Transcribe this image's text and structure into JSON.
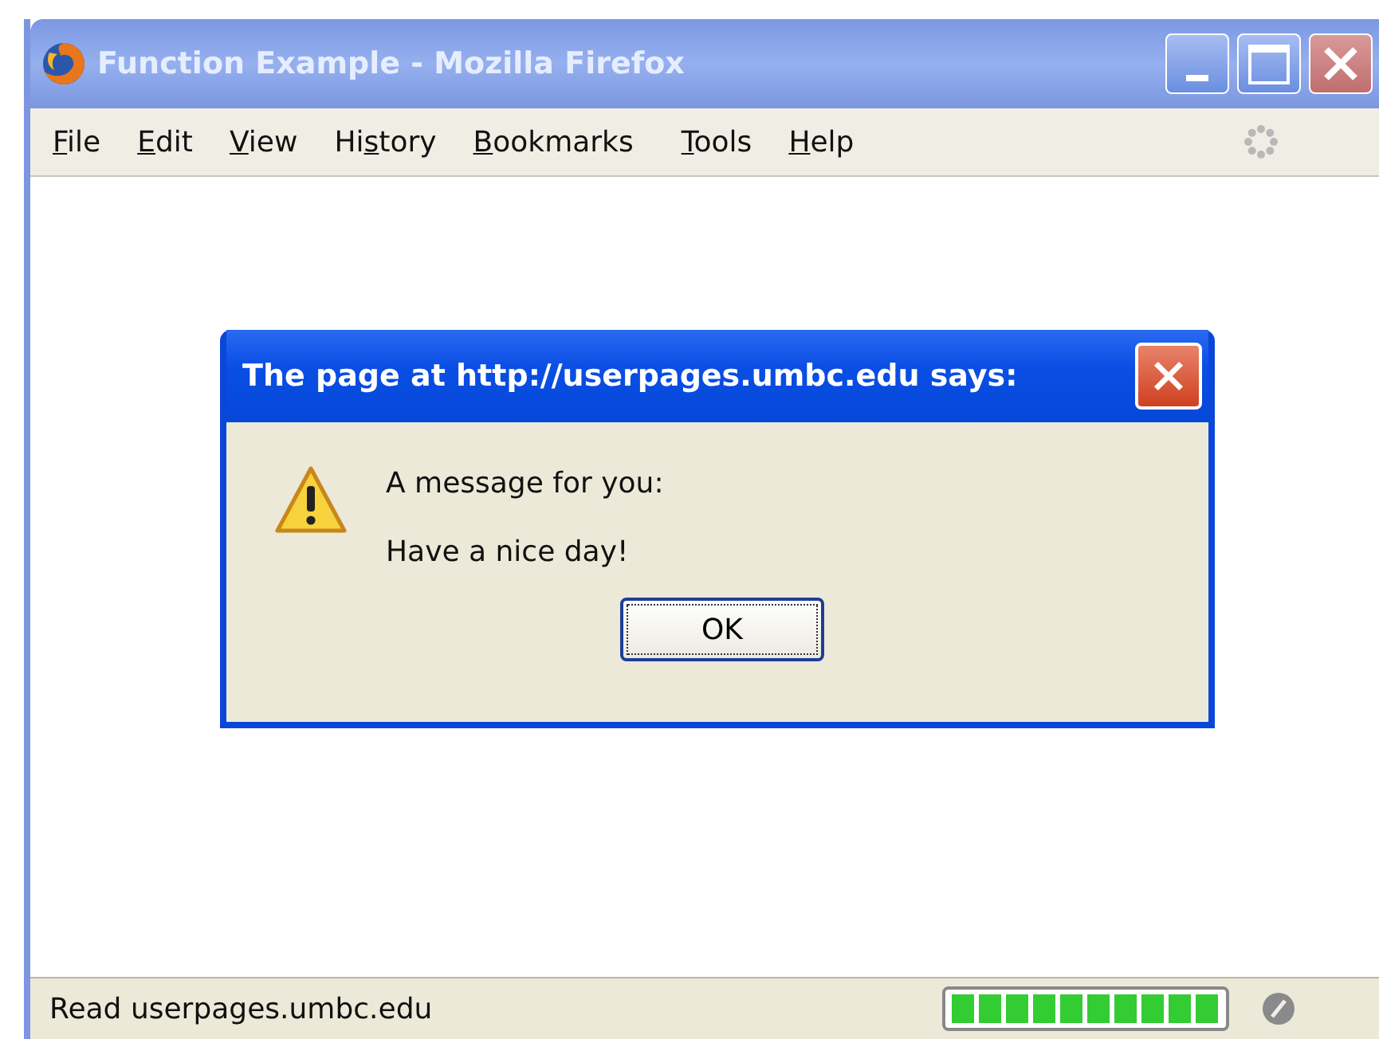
{
  "window": {
    "title": "Function Example - Mozilla Firefox"
  },
  "menu": [
    {
      "key": "F",
      "after": "ile"
    },
    {
      "key": "E",
      "after": "dit"
    },
    {
      "key": "V",
      "after": "iew"
    },
    {
      "before": "Hi",
      "key": "s",
      "after": "tory"
    },
    {
      "key": "B",
      "after": "ookmarks"
    },
    {
      "key": "T",
      "after": "ools"
    },
    {
      "key": "H",
      "after": "elp"
    }
  ],
  "dialog": {
    "title": "The page at http://userpages.umbc.edu says:",
    "lines": [
      "A message for you:",
      "Have a nice day!"
    ],
    "button": "OK"
  },
  "status_bar": {
    "text": "Read userpages.umbc.edu"
  }
}
